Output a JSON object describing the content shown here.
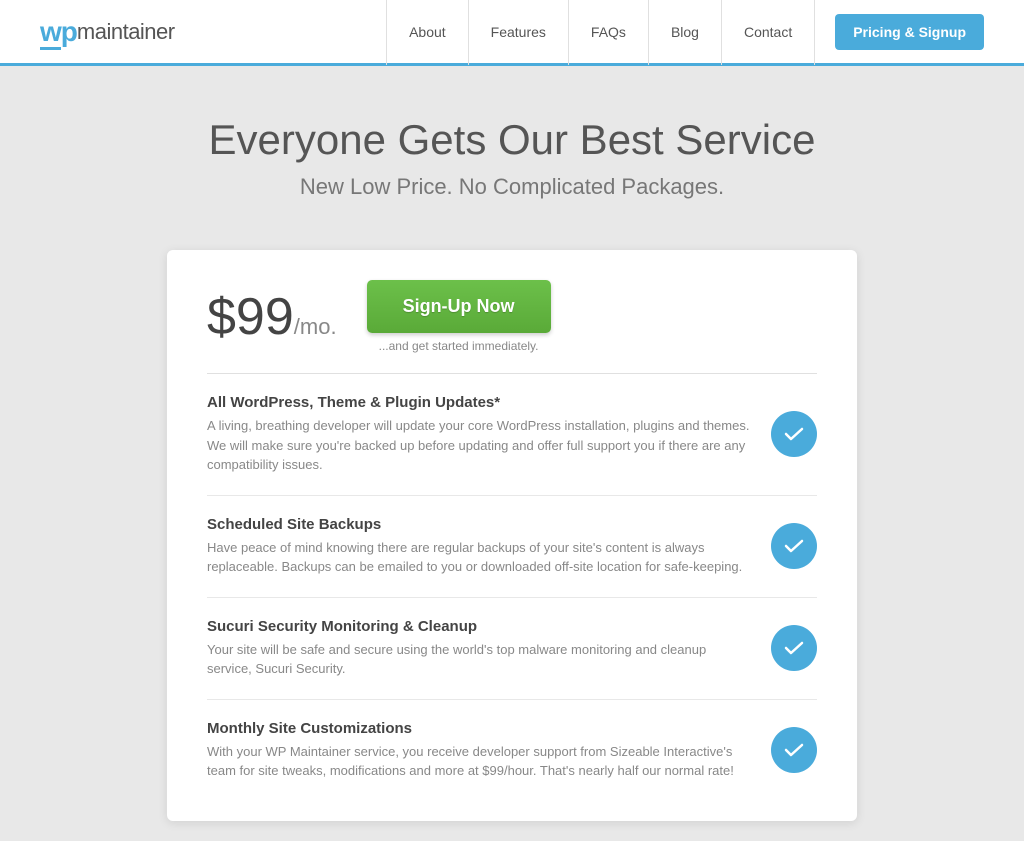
{
  "logo": {
    "wp": "wp",
    "maintainer": "maintainer"
  },
  "nav": {
    "links": [
      {
        "label": "About",
        "href": "#"
      },
      {
        "label": "Features",
        "href": "#"
      },
      {
        "label": "FAQs",
        "href": "#"
      },
      {
        "label": "Blog",
        "href": "#"
      },
      {
        "label": "Contact",
        "href": "#"
      }
    ],
    "cta_label": "Pricing & Signup"
  },
  "hero": {
    "heading": "Everyone Gets Our Best Service",
    "subheading": "New Low Price. No Complicated Packages."
  },
  "pricing": {
    "price": "$99",
    "per": "/mo.",
    "signup_button": "Sign-Up Now",
    "signup_sub": "...and get started immediately.",
    "features": [
      {
        "title": "All WordPress, Theme & Plugin Updates*",
        "desc": "A living, breathing developer will update your core WordPress installation, plugins and themes. We will make sure you're backed up before updating and offer full support you if there are any compatibility issues."
      },
      {
        "title": "Scheduled Site Backups",
        "desc": "Have peace of mind knowing there are regular backups of your site's content is always replaceable. Backups can be emailed to you or downloaded off-site location for safe-keeping."
      },
      {
        "title": "Sucuri Security Monitoring & Cleanup",
        "desc": "Your site will be safe and secure using the world's top malware monitoring and cleanup service, Sucuri Security."
      },
      {
        "title": "Monthly Site Customizations",
        "desc": "With your WP Maintainer service, you receive developer support from Sizeable Interactive's team for site tweaks, modifications and more at $99/hour. That's nearly half our normal rate!"
      }
    ]
  }
}
